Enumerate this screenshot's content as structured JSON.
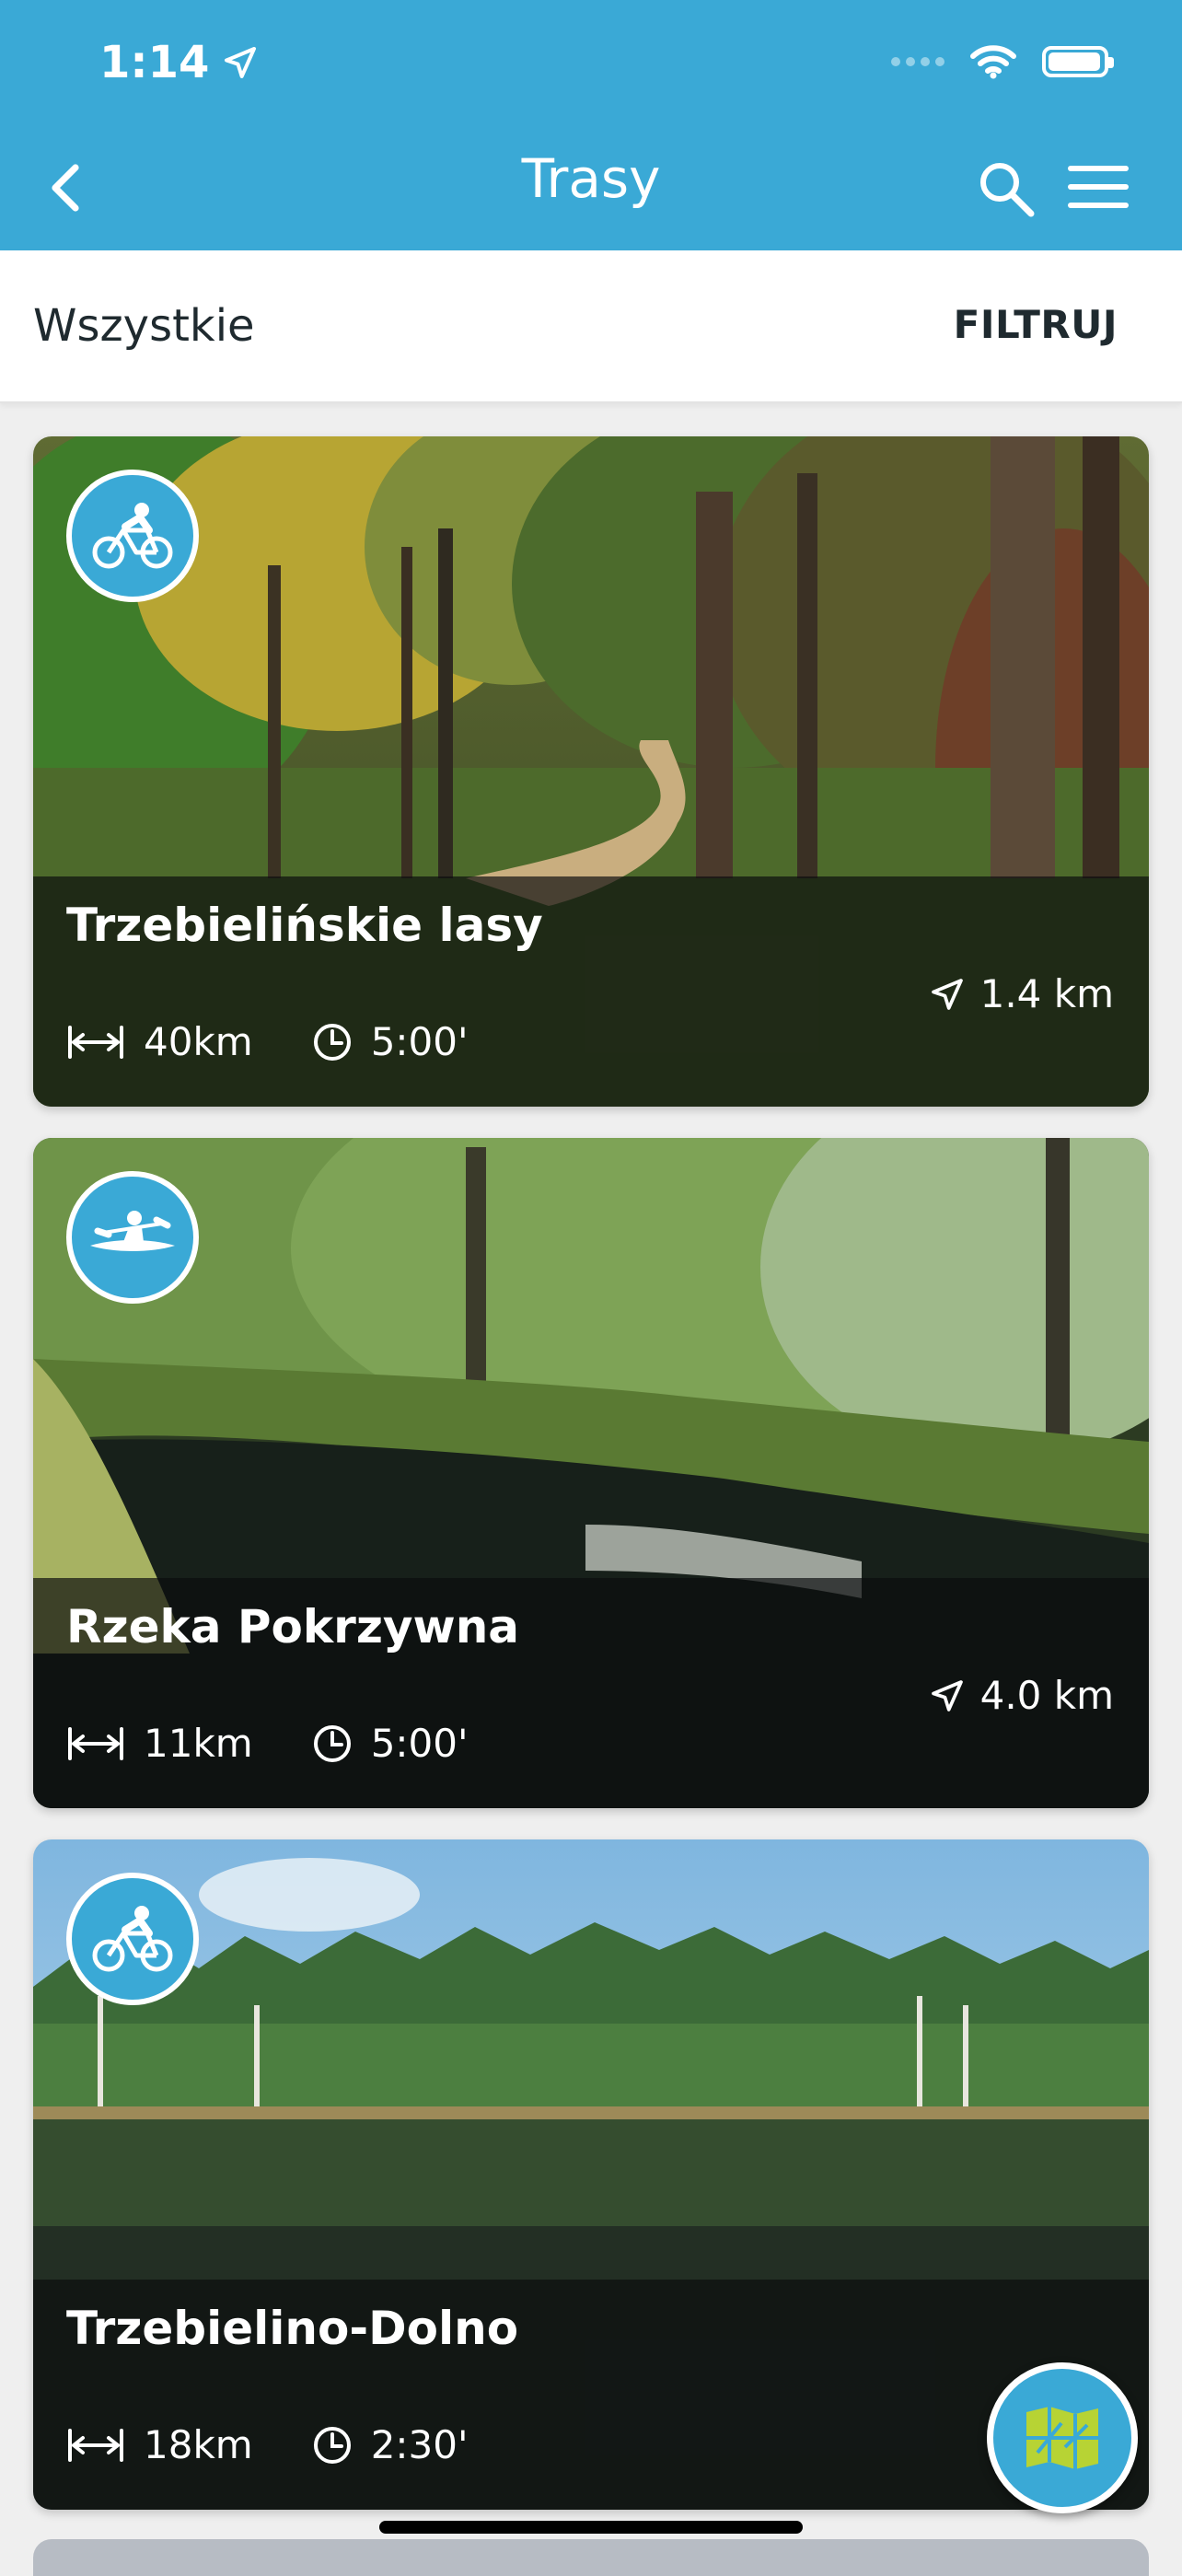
{
  "status_bar": {
    "time": "1:14"
  },
  "header": {
    "title": "Trasy"
  },
  "filter_bar": {
    "current": "Wszystkie",
    "filter_label": "FILTRUJ"
  },
  "routes": [
    {
      "title": "Trzebielińskie lasy",
      "length": "40km",
      "duration": "5:00'",
      "distance": "1.4 km",
      "type_icon": "bike-icon"
    },
    {
      "title": "Rzeka Pokrzywna",
      "length": "11km",
      "duration": "5:00'",
      "distance": "4.0 km",
      "type_icon": "kayak-icon"
    },
    {
      "title": "Trzebielino-Dolno",
      "length": "18km",
      "duration": "2:30'",
      "distance": "",
      "type_icon": "bike-icon"
    }
  ],
  "colors": {
    "primary": "#3aa9d6",
    "overlay": "#0a0c0e",
    "map_green": "#b7d334"
  }
}
